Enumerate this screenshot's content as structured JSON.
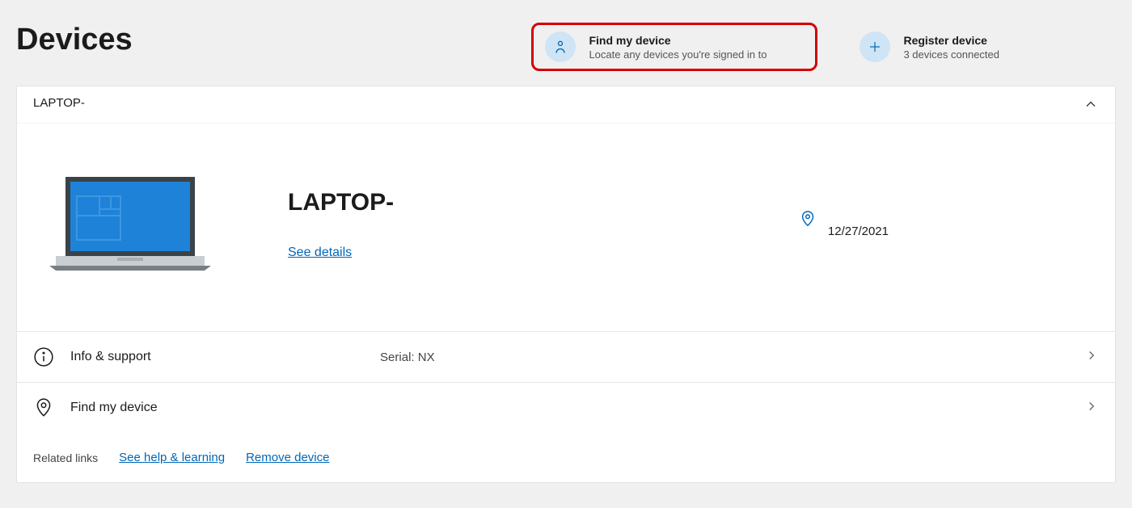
{
  "page_title": "Devices",
  "actions": {
    "find": {
      "title": "Find my device",
      "subtitle": "Locate any devices you're signed in to"
    },
    "register": {
      "title": "Register device",
      "subtitle": "3 devices connected"
    }
  },
  "device": {
    "short_name": "LAPTOP-",
    "name": "LAPTOP-",
    "see_details": "See details",
    "location_date": "12/27/2021"
  },
  "rows": {
    "info": {
      "label": "Info & support",
      "serial": "Serial: NX"
    },
    "find": {
      "label": "Find my device"
    }
  },
  "related": {
    "label": "Related links",
    "help": "See help & learning",
    "remove": "Remove device"
  }
}
